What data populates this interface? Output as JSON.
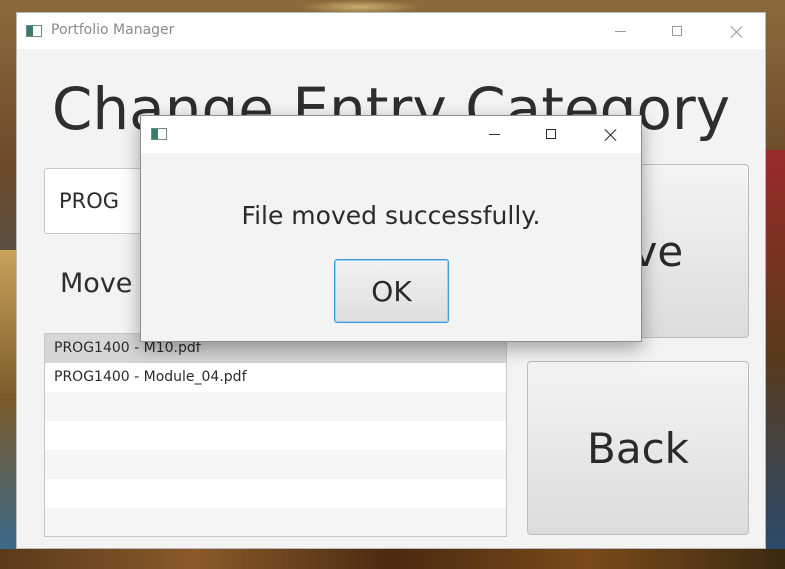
{
  "main_window": {
    "title": "Portfolio Manager",
    "page_title": "Change Entry Category",
    "category_value": "PROG",
    "move_label": "Move",
    "move_button_label": "ove",
    "back_button_label": "Back",
    "files": [
      {
        "name": "PROG1400 - M10.pdf",
        "selected": true
      },
      {
        "name": "PROG1400 - Module_04.pdf",
        "selected": false
      }
    ]
  },
  "dialog": {
    "title": "",
    "message": "File moved successfully.",
    "ok_label": "OK"
  },
  "icons": {
    "app": "app-window-icon",
    "minimize": "minimize-icon",
    "maximize": "maximize-icon",
    "close": "close-icon"
  },
  "colors": {
    "focus_border": "#3a9ad9",
    "selected_row": "#d6d6d6",
    "window_bg": "#f3f3f3"
  }
}
